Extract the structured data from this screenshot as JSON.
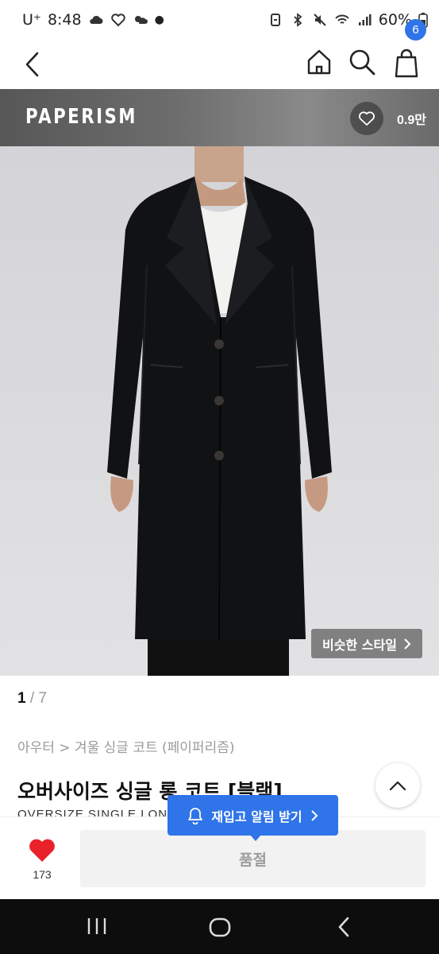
{
  "status_bar": {
    "carrier": "U⁺",
    "time": "8:48",
    "battery": "60%"
  },
  "header": {
    "cart_count": "6"
  },
  "brand": {
    "name": "PAPERISM",
    "like_count": "0.9만"
  },
  "gallery": {
    "similar_style_label": "비슷한 스타일",
    "current_index": "1",
    "separator": "/",
    "total": "7"
  },
  "product": {
    "breadcrumb": "아우터 > 겨울 싱글 코트 (페이퍼리즘)",
    "title": "오버사이즈 싱글 롱 코트 [블랙]",
    "subtitle": "OVERSIZE SINGLE LONG"
  },
  "restock": {
    "label": "재입고 알림 받기"
  },
  "bottom_bar": {
    "wish_count": "173",
    "soldout_label": "품절"
  },
  "colors": {
    "accent": "#2f74e8",
    "heart": "#e8212b",
    "soldout_bg": "#f2f2f2"
  },
  "icons": [
    "back-icon",
    "home-icon",
    "search-icon",
    "cart-icon",
    "heart-outline-icon",
    "chevron-right-icon",
    "chevron-up-icon",
    "bell-icon",
    "heart-filled-icon",
    "recent-apps-icon",
    "system-home-icon",
    "system-back-icon"
  ]
}
